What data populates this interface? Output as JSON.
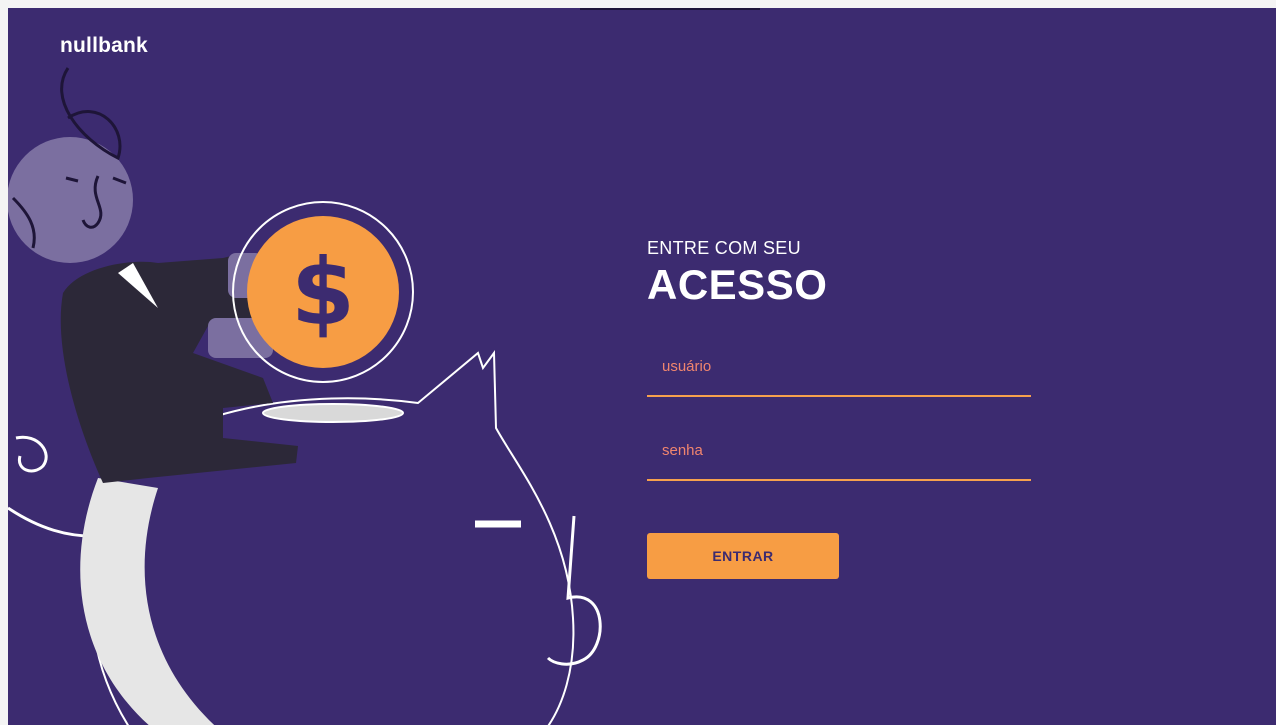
{
  "brand": {
    "name": "nullbank"
  },
  "illustration": {
    "coin_symbol": "$"
  },
  "login": {
    "subtitle": "ENTRE COM SEU",
    "title": "ACESSO",
    "username_placeholder": "usuário",
    "password_placeholder": "senha",
    "submit_label": "ENTRAR"
  },
  "colors": {
    "background": "#3c2b70",
    "accent": "#f79d44",
    "placeholder": "#f0856e",
    "figure_head": "#7b6fa0",
    "suit": "#2c2838"
  }
}
